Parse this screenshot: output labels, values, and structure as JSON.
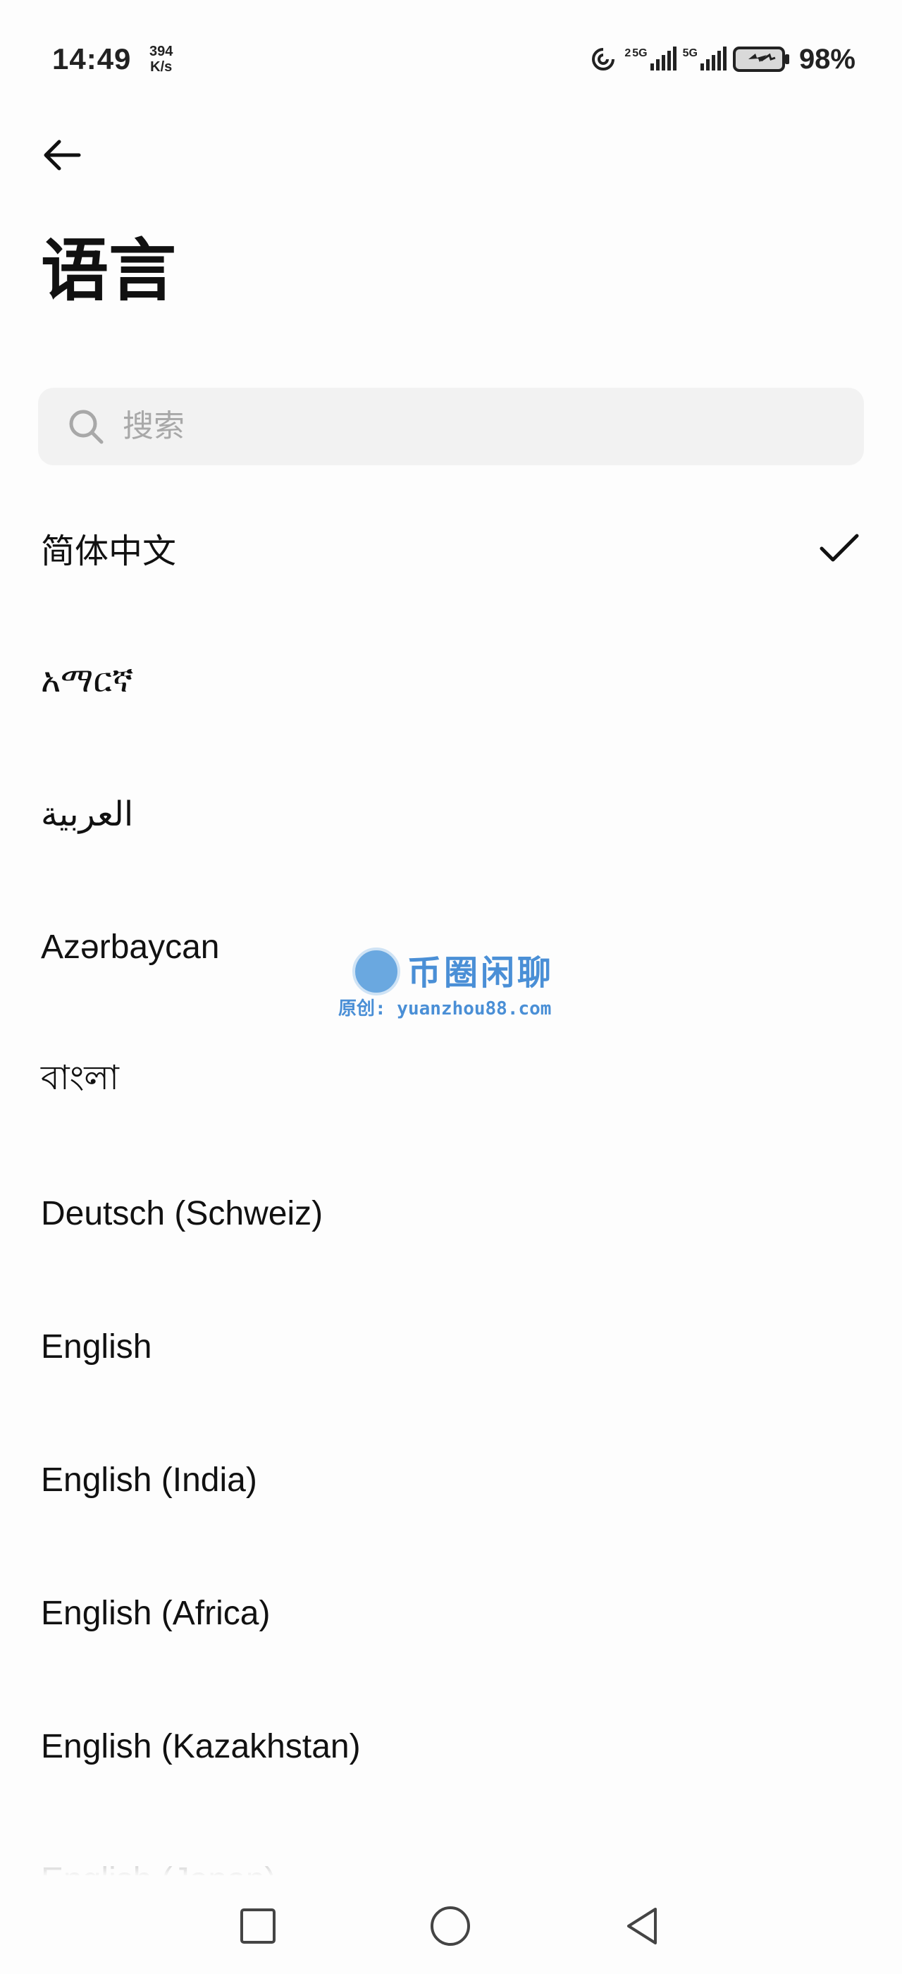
{
  "status_bar": {
    "time": "14:49",
    "net_speed_value": "394",
    "net_speed_unit": "K/s",
    "sim1_label": "2",
    "sim1_network": "5G",
    "sim2_network": "5G",
    "battery_percent": "98%"
  },
  "header": {
    "title": "语言"
  },
  "search": {
    "placeholder": "搜索"
  },
  "languages": [
    {
      "label": "简体中文",
      "selected": true
    },
    {
      "label": "አማርኛ",
      "selected": false
    },
    {
      "label": "العربية",
      "selected": false
    },
    {
      "label": "Azərbaycan",
      "selected": false
    },
    {
      "label": "বাংলা",
      "selected": false
    },
    {
      "label": "Deutsch (Schweiz)",
      "selected": false
    },
    {
      "label": "English",
      "selected": false
    },
    {
      "label": "English (India)",
      "selected": false
    },
    {
      "label": "English (Africa)",
      "selected": false
    },
    {
      "label": "English (Kazakhstan)",
      "selected": false
    },
    {
      "label": "English (Japan)",
      "selected": false
    }
  ],
  "watermark": {
    "title": "币圈闲聊",
    "subtitle": "原创: yuanzhou88.com"
  },
  "icons": {
    "back": "arrow-left-icon",
    "search": "search-icon",
    "selected": "check-icon",
    "nav_recents": "square-icon",
    "nav_home": "circle-icon",
    "nav_back": "triangle-left-icon"
  },
  "colors": {
    "background": "#fdfdfd",
    "search_bg": "#f2f2f2",
    "text": "#111111",
    "placeholder": "#a8a8a8",
    "watermark": "#4a8fd6"
  }
}
